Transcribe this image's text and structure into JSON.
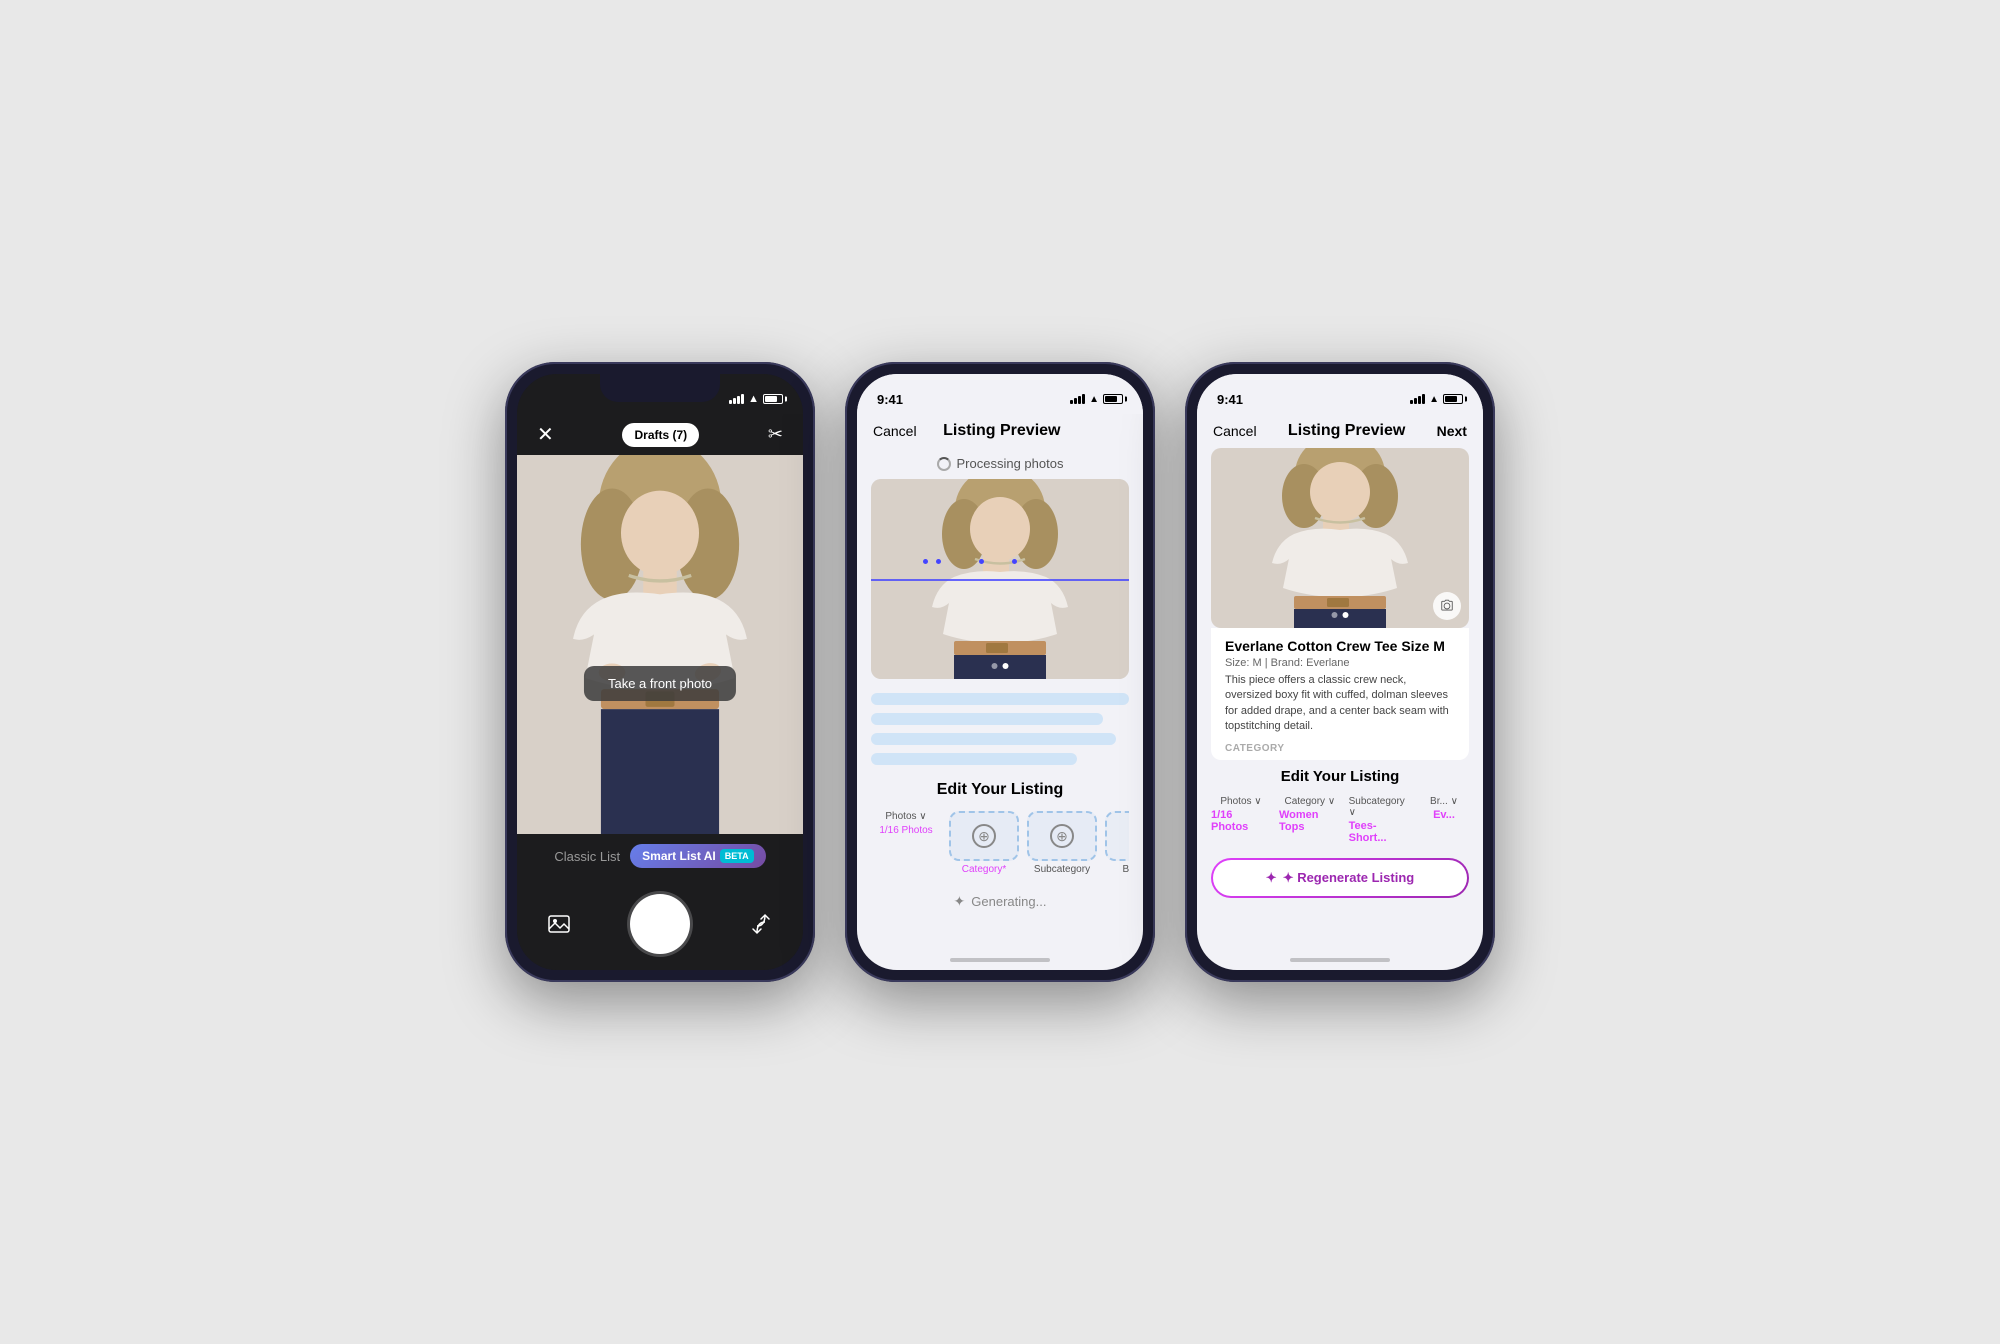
{
  "phone1": {
    "status": {
      "time": "",
      "signal": true,
      "wifi": true,
      "battery": true
    },
    "top": {
      "close_label": "✕",
      "drafts_label": "Drafts (7)",
      "scissors_label": "✂"
    },
    "photo_prompt": "Take a front photo",
    "modes": {
      "classic": "Classic List",
      "smart": "Smart List AI",
      "beta": "BETA"
    },
    "bottom_icons": {
      "gallery": "🖼",
      "shutter": "",
      "flip": "↺"
    }
  },
  "phone2": {
    "status": {
      "time": "9:41"
    },
    "nav": {
      "cancel": "Cancel",
      "title": "Listing Preview",
      "next": ""
    },
    "processing": "Processing photos",
    "edit_section": {
      "title": "Edit Your Listing",
      "tabs": [
        {
          "label": "Photos",
          "sublabel": "1/16 Photos",
          "icon": "⊕",
          "active": false
        },
        {
          "label": "Category*",
          "sublabel": "",
          "icon": "⊕",
          "active": true
        },
        {
          "label": "Subcategory",
          "sublabel": "",
          "icon": "⊕",
          "active": true
        },
        {
          "label": "B...",
          "sublabel": "",
          "icon": "",
          "active": false
        }
      ]
    },
    "generating": "Generating..."
  },
  "phone3": {
    "status": {
      "time": "9:41"
    },
    "nav": {
      "cancel": "Cancel",
      "title": "Listing Preview",
      "next": "Next"
    },
    "listing": {
      "title": "Everlane Cotton Crew Tee Size M",
      "meta": "Size: M  |  Brand: Everlane",
      "description": "This piece offers a classic crew neck, oversized boxy fit with cuffed, dolman sleeves for added drape, and a center back seam with topstitching detail.",
      "category_label": "CATEGORY"
    },
    "edit_section": {
      "title": "Edit Your Listing",
      "tabs": [
        {
          "label": "Photos",
          "sublabel": "1/16 Photos",
          "value_color": "pink"
        },
        {
          "label": "Category",
          "sublabel": "Women Tops",
          "value_color": "pink"
        },
        {
          "label": "Subcategory",
          "sublabel": "Tees- Short...",
          "value_color": "pink"
        },
        {
          "label": "Br...",
          "sublabel": "Ev...",
          "value_color": "pink"
        }
      ]
    },
    "regenerate_btn": "✦ Regenerate Listing"
  }
}
